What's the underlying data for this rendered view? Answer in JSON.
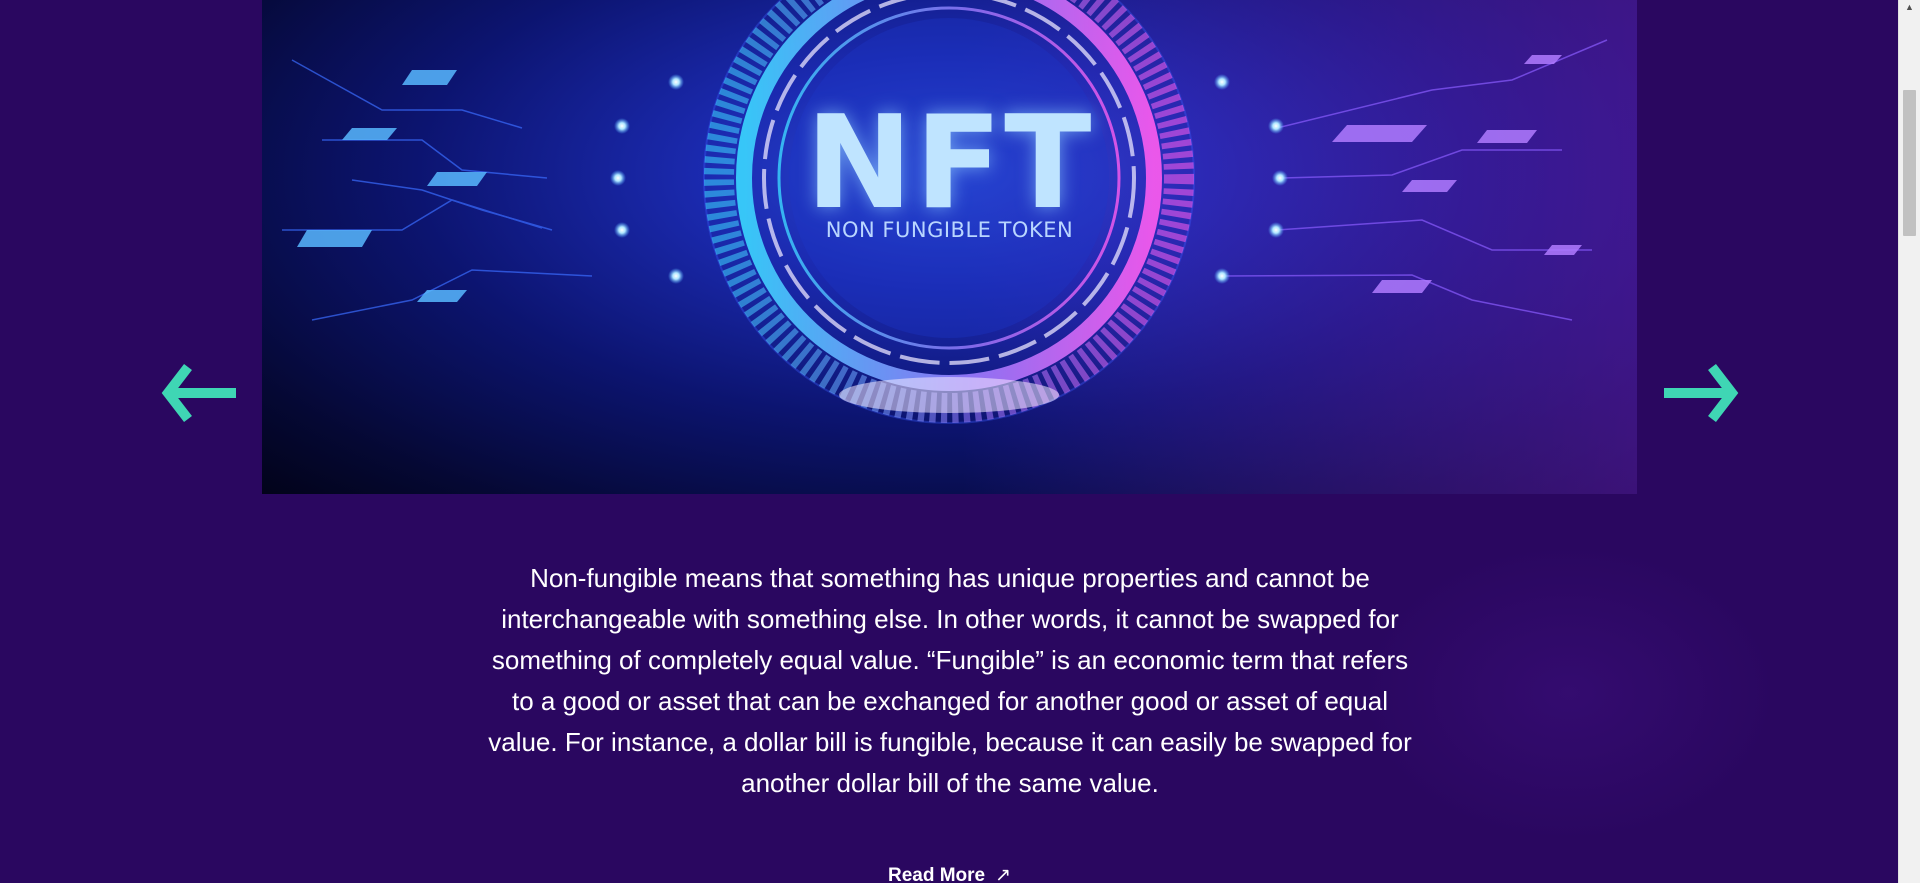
{
  "banner": {
    "title": "NFT",
    "subtitle": "NON FUNGIBLE TOKEN"
  },
  "carousel": {
    "prev_icon": "arrow-left-icon",
    "next_icon": "arrow-right-icon",
    "accent_color": "#3fd6b4"
  },
  "description": "Non-fungible means that something has unique properties and cannot be interchangeable with something else. In other words, it cannot be swapped for something of completely equal value. “Fungible” is an economic term that refers to a good or asset that can be exchanged for another good or asset of equal value. For instance, a dollar bill is fungible, because it can easily be swapped for another dollar bill of the same value.",
  "read_more": {
    "label": "Read More",
    "icon": "↗"
  },
  "colors": {
    "background": "#2a0760",
    "text": "#ffffff"
  },
  "scrollbar": {
    "up_icon": "▲"
  }
}
